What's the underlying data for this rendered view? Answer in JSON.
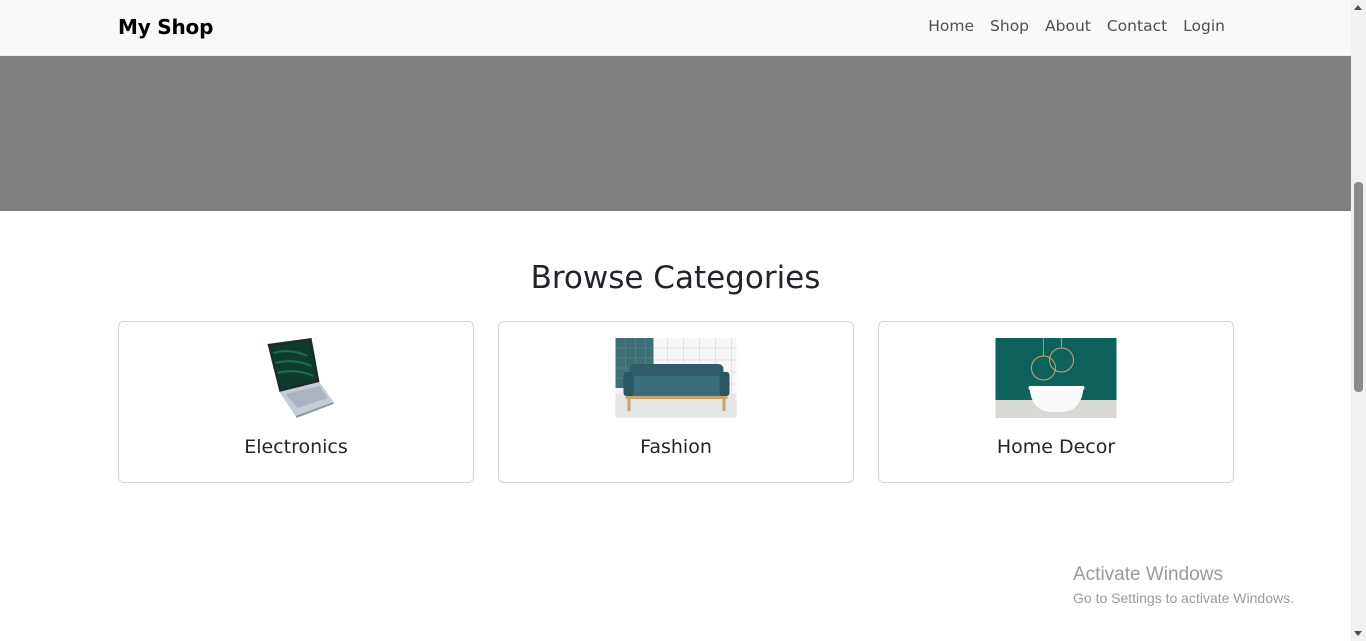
{
  "navbar": {
    "brand": "My Shop",
    "links": [
      "Home",
      "Shop",
      "About",
      "Contact",
      "Login"
    ]
  },
  "section": {
    "title": "Browse Categories"
  },
  "categories": [
    {
      "title": "Electronics",
      "image": "laptop-image"
    },
    {
      "title": "Fashion",
      "image": "sofa-image"
    },
    {
      "title": "Home Decor",
      "image": "bathtub-image"
    }
  ],
  "watermark": {
    "title": "Activate Windows",
    "subtitle": "Go to Settings to activate Windows."
  },
  "colors": {
    "navbar_bg": "#f8f9fa",
    "hero_bg": "#808080",
    "text": "#212529",
    "card_border": "#d0d4d8"
  }
}
